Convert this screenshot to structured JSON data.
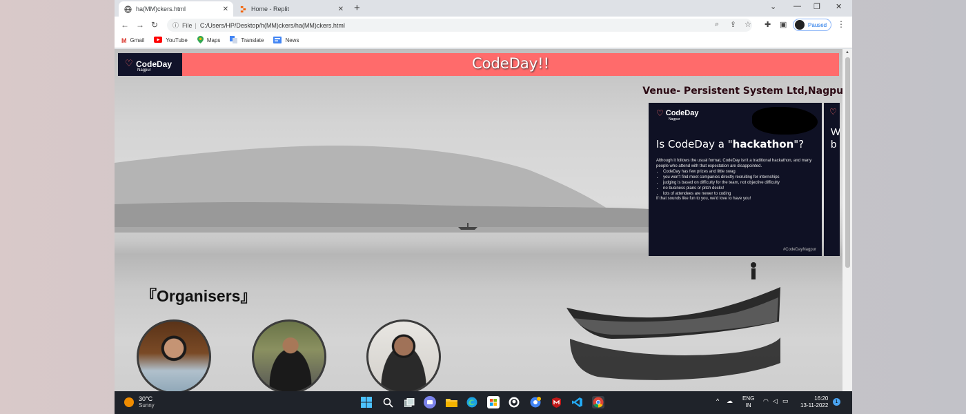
{
  "browser": {
    "tabs": [
      {
        "title": "ha(MM)ckers.html",
        "icon": "globe-icon",
        "active": true
      },
      {
        "title": "Home - Replit",
        "icon": "replit-icon",
        "active": false
      }
    ],
    "address": {
      "scheme_label": "File",
      "url": "C:/Users/HP/Desktop/h(MM)ckers/ha(MM)ckers.html"
    },
    "profile_label": "Paused",
    "bookmarks": [
      {
        "label": "Gmail",
        "icon": "gmail-icon"
      },
      {
        "label": "YouTube",
        "icon": "youtube-icon"
      },
      {
        "label": "Maps",
        "icon": "maps-icon"
      },
      {
        "label": "Translate",
        "icon": "translate-icon"
      },
      {
        "label": "News",
        "icon": "news-icon"
      }
    ]
  },
  "site": {
    "logo": {
      "name": "CodeDay",
      "city": "Nagpur"
    },
    "title": "CodeDay!!",
    "venue": "Venue- Persistent System Ltd,Nagpur",
    "slide": {
      "logo_name": "CodeDay",
      "logo_city": "Nagpur",
      "question_pre": "Is CodeDay a \"",
      "question_bold": "hackathon",
      "question_post": "\"?",
      "intro": "Although it follows the usual format, CodeDay isn't a traditional hackathon, and many people who attend with that expectation are disappointed.",
      "bullets": [
        "CodeDay has few prizes and little swag",
        "you won't find meet companies directly recruiting for internships",
        "judging is based on difficulty for the team, not objective difficulty",
        "no business plans or pitch decks!",
        "lots of attendees are newer to coding"
      ],
      "closing": "If that sounds like fun to you, we'd love to have you!",
      "hashtag": "#CodeDayNagpur"
    },
    "slide2": {
      "line1": "W",
      "line2": "b"
    },
    "organisers_title": "『Organisers』"
  },
  "taskbar": {
    "weather": {
      "temp": "30°C",
      "condition": "Sunny"
    },
    "lang": {
      "line1": "ENG",
      "line2": "IN"
    },
    "clock": {
      "time": "16:20",
      "date": "13-11-2022"
    },
    "notifications": "1"
  },
  "colors": {
    "header": "#ff6b6b",
    "logo_bg": "#11132a",
    "slide_bg": "#0f1124",
    "taskbar": "#1f232a"
  }
}
